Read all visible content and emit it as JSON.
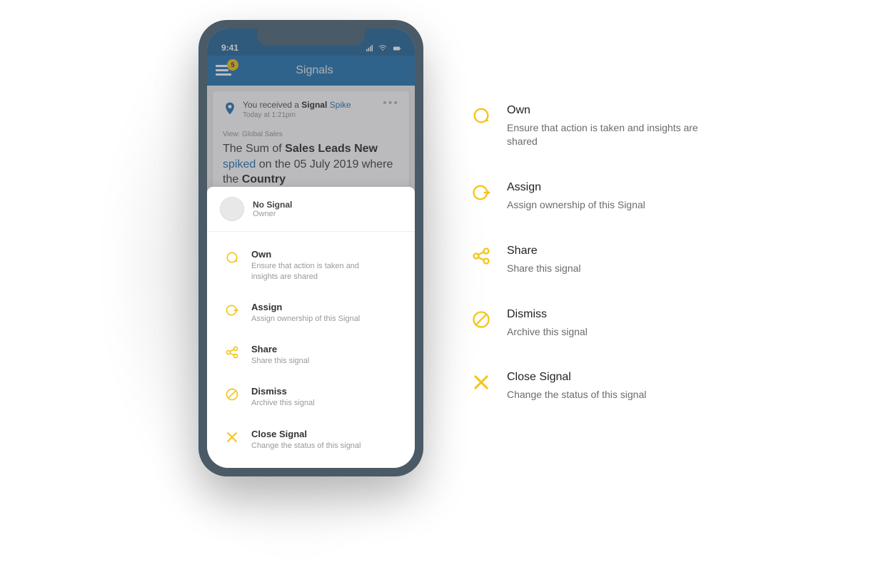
{
  "statusbar": {
    "time": "9:41"
  },
  "header": {
    "title": "Signals",
    "badge": "5"
  },
  "card": {
    "prefix": "You received a ",
    "signal_word": "Signal",
    "spike": "Spike",
    "time": "Today at 1:21pm",
    "view": "View: Global Sales",
    "body_prefix": "The Sum of ",
    "metric": "Sales Leads New",
    "spiked": "spiked",
    "body_mid": " on the 05 July 2019 where the ",
    "country": "Country"
  },
  "sheet": {
    "owner_title": "No Signal",
    "owner_sub": "Owner"
  },
  "actions": [
    {
      "icon": "own",
      "title": "Own",
      "desc": "Ensure that action is taken and insights are shared"
    },
    {
      "icon": "assign",
      "title": "Assign",
      "desc": "Assign ownership of this Signal"
    },
    {
      "icon": "share",
      "title": "Share",
      "desc": "Share this signal"
    },
    {
      "icon": "dismiss",
      "title": "Dismiss",
      "desc": "Archive this signal"
    },
    {
      "icon": "close",
      "title": "Close Signal",
      "desc": "Change the status of this signal"
    }
  ]
}
